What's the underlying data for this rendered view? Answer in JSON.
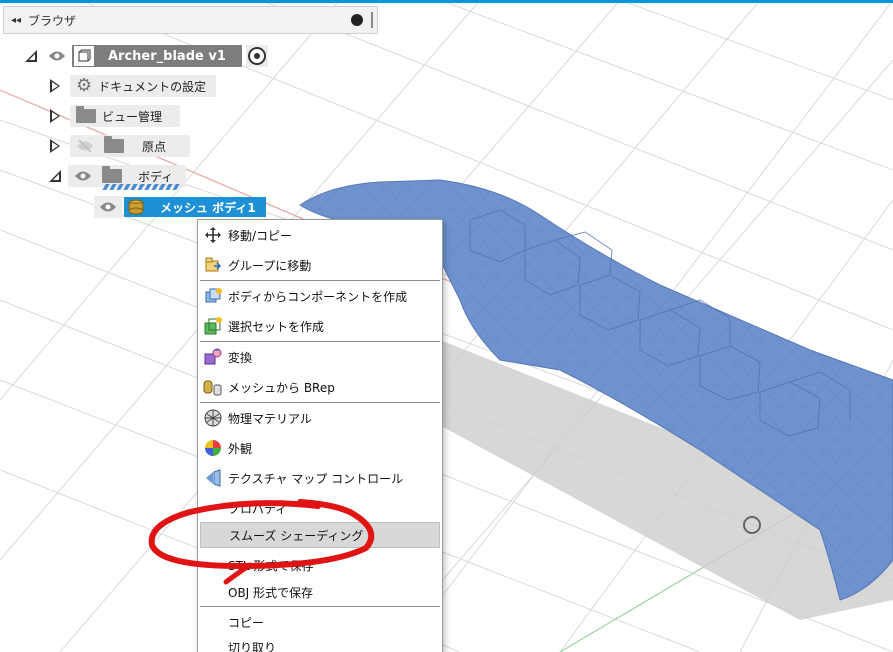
{
  "browser": {
    "title": "ブラウザ",
    "collapse_glyph": "◂◂"
  },
  "tree": {
    "root_label": "Archer_blade v1",
    "items": [
      {
        "label": "ドキュメントの設定",
        "icon": "gear-icon"
      },
      {
        "label": "ビュー管理",
        "icon": "folder-icon"
      },
      {
        "label": "原点",
        "icon": "folder-icon"
      },
      {
        "label": "ボディ",
        "icon": "folder-icon"
      }
    ],
    "selected_label": "メッシュ ボディ1"
  },
  "menu": {
    "items": [
      {
        "label": "移動/コピー",
        "icon": "move-icon"
      },
      {
        "label": "グループに移動",
        "icon": "group-move-icon"
      },
      {
        "label": "ボディからコンポーネントを作成",
        "icon": "create-component-icon"
      },
      {
        "label": "選択セットを作成",
        "icon": "selection-set-icon"
      },
      {
        "label": "変換",
        "icon": "convert-icon"
      },
      {
        "label": "メッシュから BRep",
        "icon": "mesh-to-brep-icon"
      },
      {
        "label": "物理マテリアル",
        "icon": "physical-material-icon"
      },
      {
        "label": "外観",
        "icon": "appearance-icon"
      },
      {
        "label": "テクスチャ マップ コントロール",
        "icon": "texture-map-icon"
      },
      {
        "label": "プロパティ",
        "icon": ""
      },
      {
        "label": "スムーズ シェーディング",
        "icon": ""
      },
      {
        "label": "STL 形式で保存",
        "icon": ""
      },
      {
        "label": "OBJ 形式で保存",
        "icon": ""
      },
      {
        "label": "コピー",
        "icon": ""
      },
      {
        "label": "切り取り",
        "icon": ""
      }
    ]
  },
  "colors": {
    "accent": "#0696d7",
    "selection": "#1e90d6",
    "mesh": "#6f93cf",
    "annotation": "#e01414"
  }
}
